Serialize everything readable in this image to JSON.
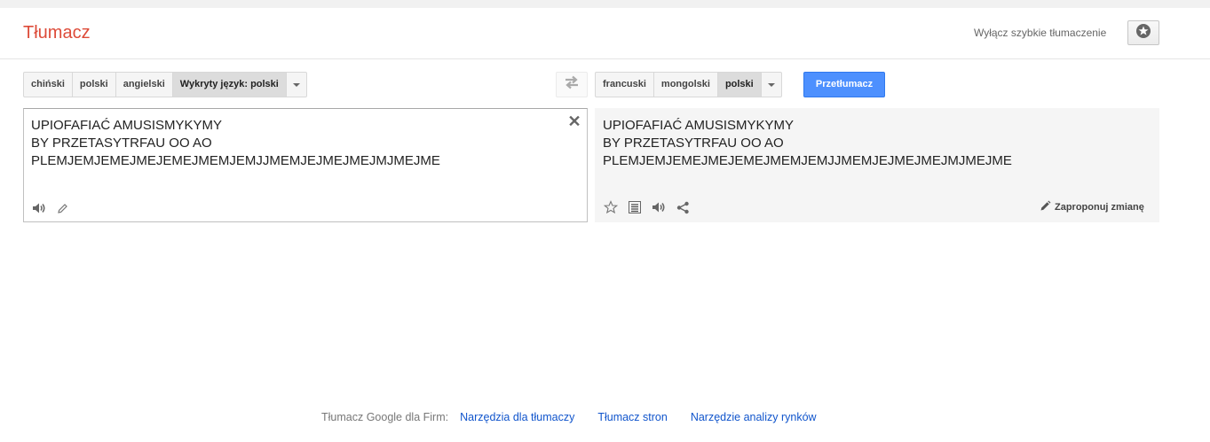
{
  "header": {
    "title": "Tłumacz",
    "instant_toggle": "Wyłącz szybkie tłumaczenie"
  },
  "source": {
    "languages": [
      {
        "label": "chiński",
        "active": false
      },
      {
        "label": "polski",
        "active": false
      },
      {
        "label": "angielski",
        "active": false
      },
      {
        "label": "Wykryty język: polski",
        "active": true
      }
    ],
    "text": "UPIOFAFIAĆ AMUSISMYKYMY\nBY PRZETASYTRFAU OO AO\nPLEMJEMJEMEJMEJEMEJMEMJEMJJMEMJEJMEJMEJMJMEJME"
  },
  "target": {
    "languages": [
      {
        "label": "francuski",
        "active": false
      },
      {
        "label": "mongolski",
        "active": false
      },
      {
        "label": "polski",
        "active": true
      }
    ],
    "text": "UPIOFAFIAĆ AMUSISMYKYMY\nBY PRZETASYTRFAU OO AO\nPLEMJEMJEMEJMEJEMEJMEMJEMJJMEMJEJMEJMEJMJMEJME",
    "suggest_label": "Zaproponuj zmianę"
  },
  "translate_button": "Przetłumacz",
  "footer": {
    "label": "Tłumacz Google dla Firm:",
    "links": [
      "Narzędzia dla tłumaczy",
      "Tłumacz stron",
      "Narzędzie analizy rynków"
    ]
  },
  "colors": {
    "brand_red": "#dd4b39",
    "button_blue": "#4d90fe",
    "link_blue": "#1155cc"
  }
}
